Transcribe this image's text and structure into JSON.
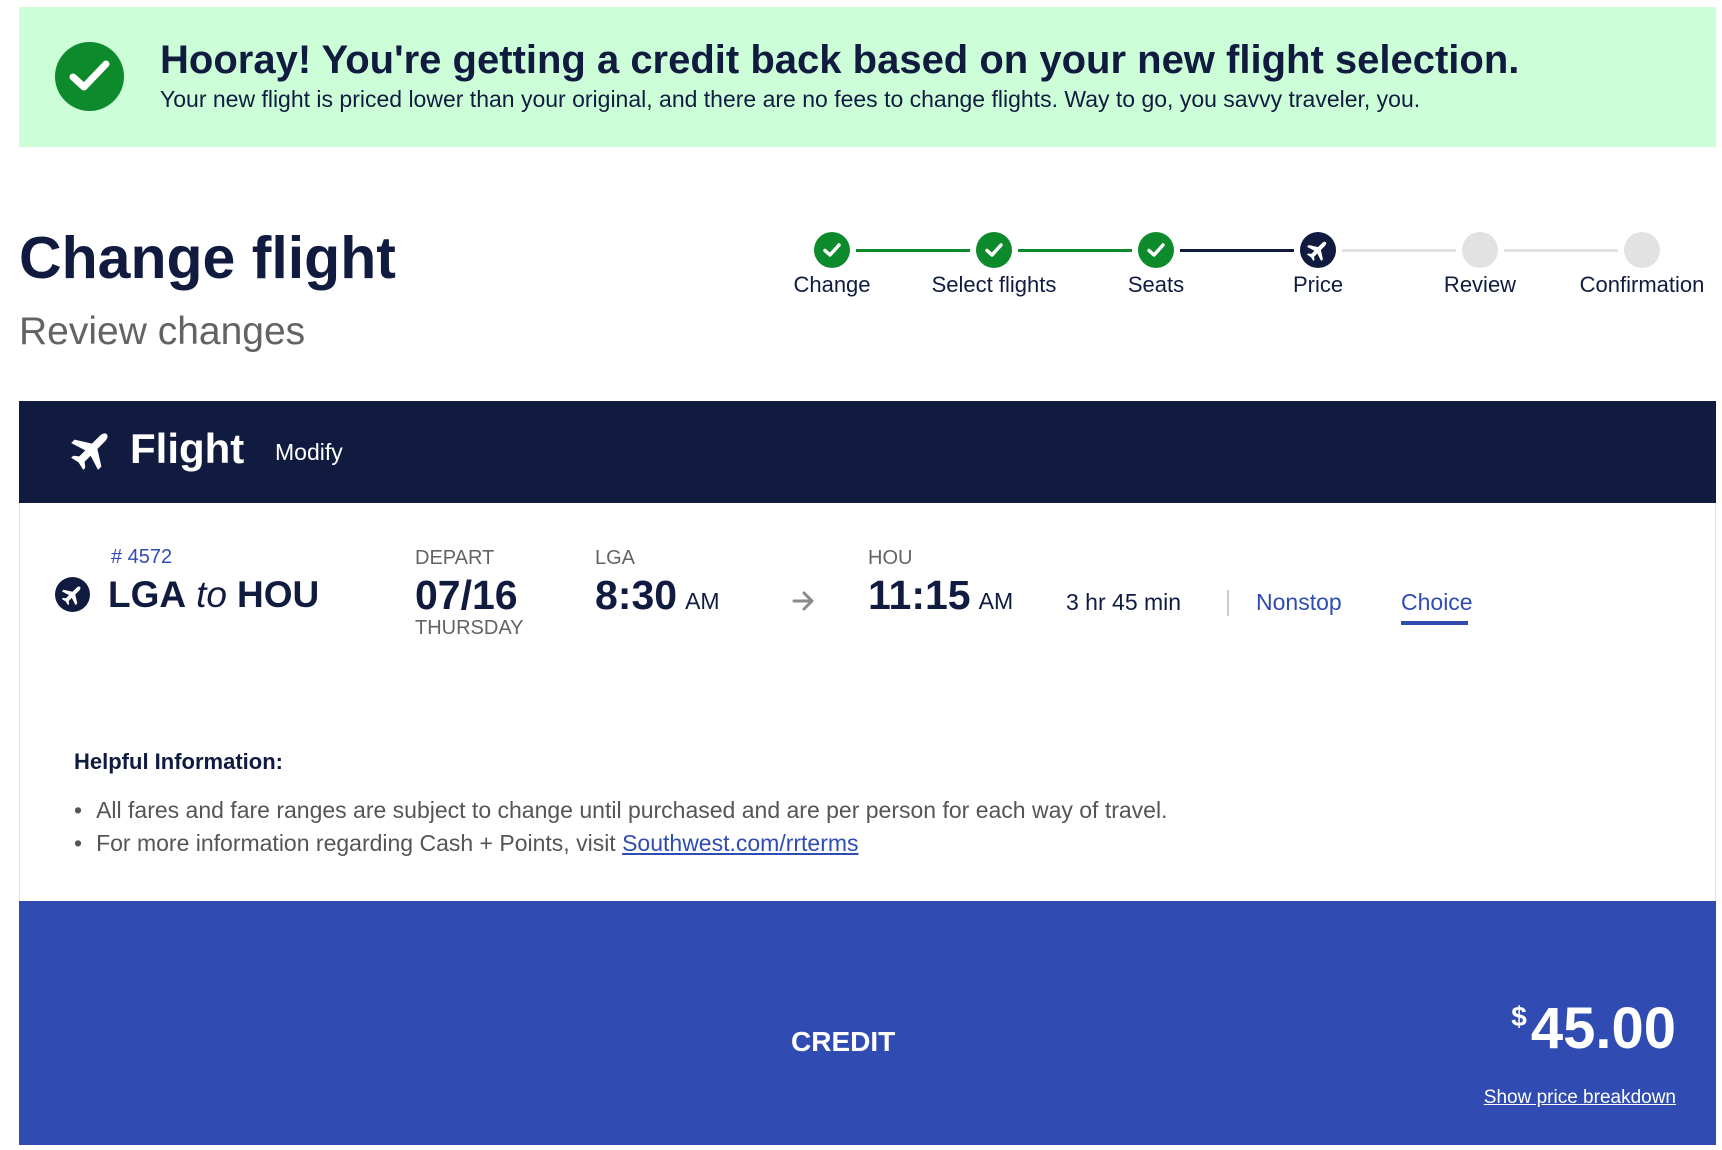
{
  "banner": {
    "title": "Hooray! You're getting a credit back based on your new flight selection.",
    "message": "Your new flight is priced lower than your original, and there are no fees to change flights. Way to go, you savvy traveler, you.",
    "icon": "checkmark-icon",
    "color": "#ccffd8"
  },
  "header": {
    "title": "Change flight",
    "subtitle": "Review changes"
  },
  "stepper": {
    "steps": [
      {
        "label": "Change",
        "state": "complete"
      },
      {
        "label": "Select flights",
        "state": "complete"
      },
      {
        "label": "Seats",
        "state": "complete"
      },
      {
        "label": "Price",
        "state": "current"
      },
      {
        "label": "Review",
        "state": "upcoming"
      },
      {
        "label": "Confirmation",
        "state": "upcoming"
      }
    ]
  },
  "flight_section": {
    "title": "Flight",
    "modify_label": "Modify",
    "icon": "airplane-icon"
  },
  "flight": {
    "number": "# 4572",
    "origin": "LGA",
    "to_word": "to",
    "destination": "HOU",
    "depart_label": "DEPART",
    "date": "07/16",
    "day": "THURSDAY",
    "depart_airport": "LGA",
    "depart_time": "8:30",
    "depart_ampm": "AM",
    "arrive_airport": "HOU",
    "arrive_time": "11:15",
    "arrive_ampm": "AM",
    "duration": "3 hr 45 min",
    "stops": "Nonstop",
    "fare": "Choice"
  },
  "info": {
    "title": "Helpful Information:",
    "items": [
      "All fares and fare ranges are subject to change until purchased and are per person for each way of travel.",
      "For more information regarding Cash + Points, visit "
    ],
    "link_text": "Southwest.com/rrterms"
  },
  "credit": {
    "label": "CREDIT",
    "currency": "$",
    "amount": "45.00",
    "breakdown_link": "Show price breakdown",
    "color": "#304cb2"
  },
  "colors": {
    "navy": "#111b40",
    "green": "#0d8a2c",
    "blue": "#304cb2",
    "gray": "#e2e2e2"
  }
}
